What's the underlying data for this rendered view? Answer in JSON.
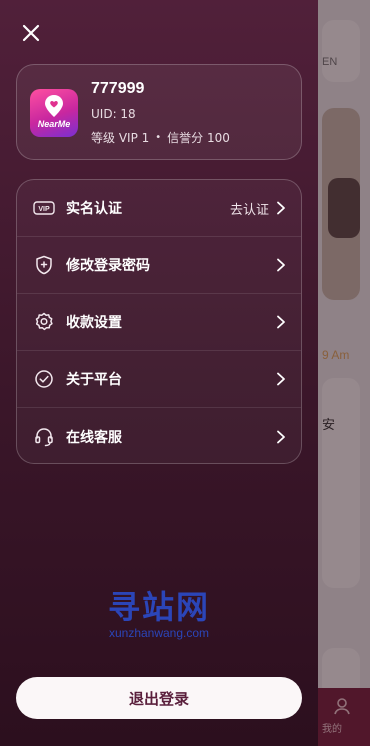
{
  "user": {
    "name": "777999",
    "uid": "UID: 18",
    "level": "等级 VIP 1",
    "separator": "•",
    "credit": "信誉分 100"
  },
  "app_logo": {
    "text": "NearMe"
  },
  "menu": {
    "items": [
      {
        "label": "实名认证",
        "extra": "去认证",
        "icon": "vip-badge-icon"
      },
      {
        "label": "修改登录密码",
        "extra": "",
        "icon": "shield-plus-icon"
      },
      {
        "label": "收款设置",
        "extra": "",
        "icon": "gear-icon"
      },
      {
        "label": "关于平台",
        "extra": "",
        "icon": "check-circle-icon"
      },
      {
        "label": "在线客服",
        "extra": "",
        "icon": "headset-icon"
      }
    ]
  },
  "vip_icon_text": "VIP",
  "logout_label": "退出登录",
  "watermark": {
    "big": "寻站网",
    "small": "xunzhanwang.com"
  },
  "background": {
    "text1": "EN",
    "text2": "9 Am",
    "text3": "安",
    "bottom_tab_label": "我的"
  },
  "colors": {
    "drawer_top": "#51203a",
    "drawer_bottom": "#2c0f1e",
    "logout_text": "#5a1f3c",
    "logo_gradient_start": "#ff4fa0",
    "logo_gradient_end": "#7a2fd1"
  }
}
